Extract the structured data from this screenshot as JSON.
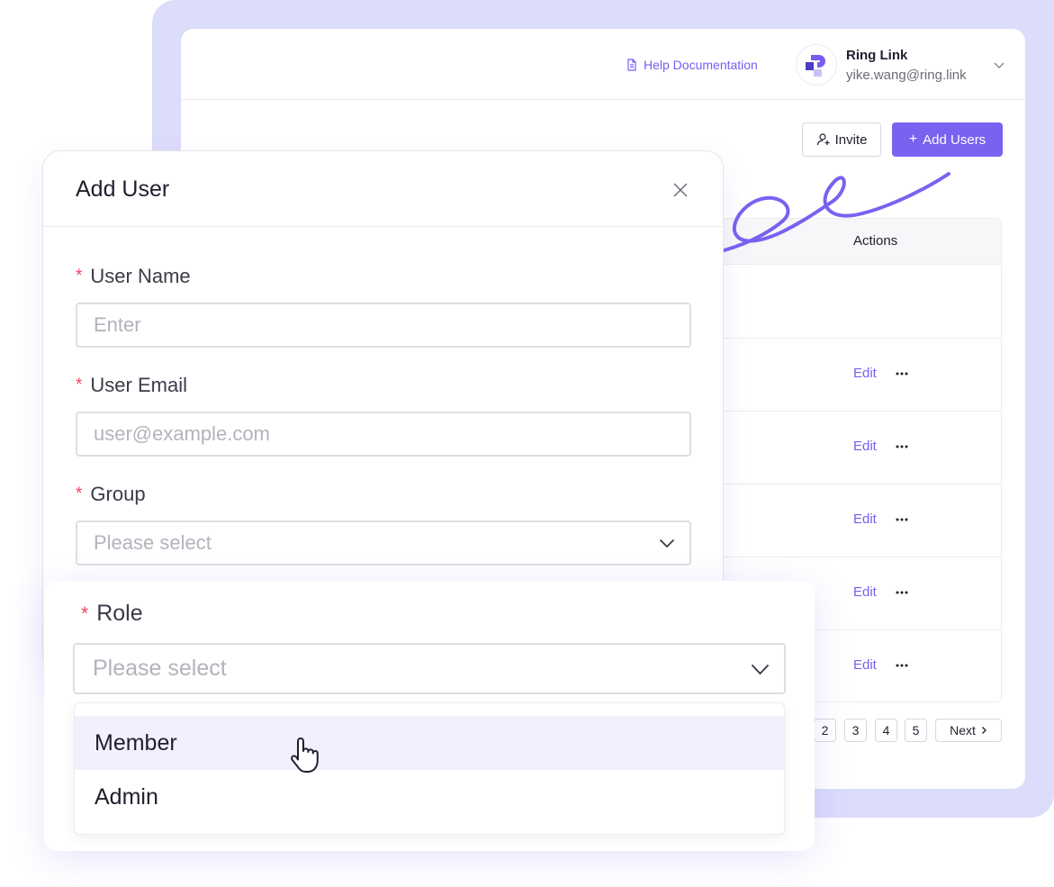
{
  "header": {
    "help_link": "Help Documentation",
    "account_name": "Ring Link",
    "account_email": "yike.wang@ring.link"
  },
  "toolbar": {
    "invite_label": "Invite",
    "add_users_label": "Add Users"
  },
  "table": {
    "actions_header": "Actions",
    "rows": [
      {
        "edit_label": "Edit"
      },
      {
        "edit_label": "Edit"
      },
      {
        "edit_label": "Edit"
      },
      {
        "edit_label": "Edit"
      },
      {
        "edit_label": "Edit"
      }
    ]
  },
  "pagination": {
    "pages": [
      "2",
      "3",
      "4",
      "5"
    ],
    "next_label": "Next"
  },
  "modal": {
    "title": "Add User",
    "fields": {
      "user_name": {
        "label": "User Name",
        "placeholder": "Enter"
      },
      "user_email": {
        "label": "User Email",
        "placeholder": "user@example.com"
      },
      "group": {
        "label": "Group",
        "placeholder": "Please select"
      }
    }
  },
  "role": {
    "label": "Role",
    "placeholder": "Please select",
    "options": [
      "Member",
      "Admin"
    ]
  },
  "colors": {
    "accent": "#7a61f0",
    "background_panel": "#dcdcfb",
    "required_marker": "#f04261",
    "option_hover": "#f1f0fc"
  }
}
